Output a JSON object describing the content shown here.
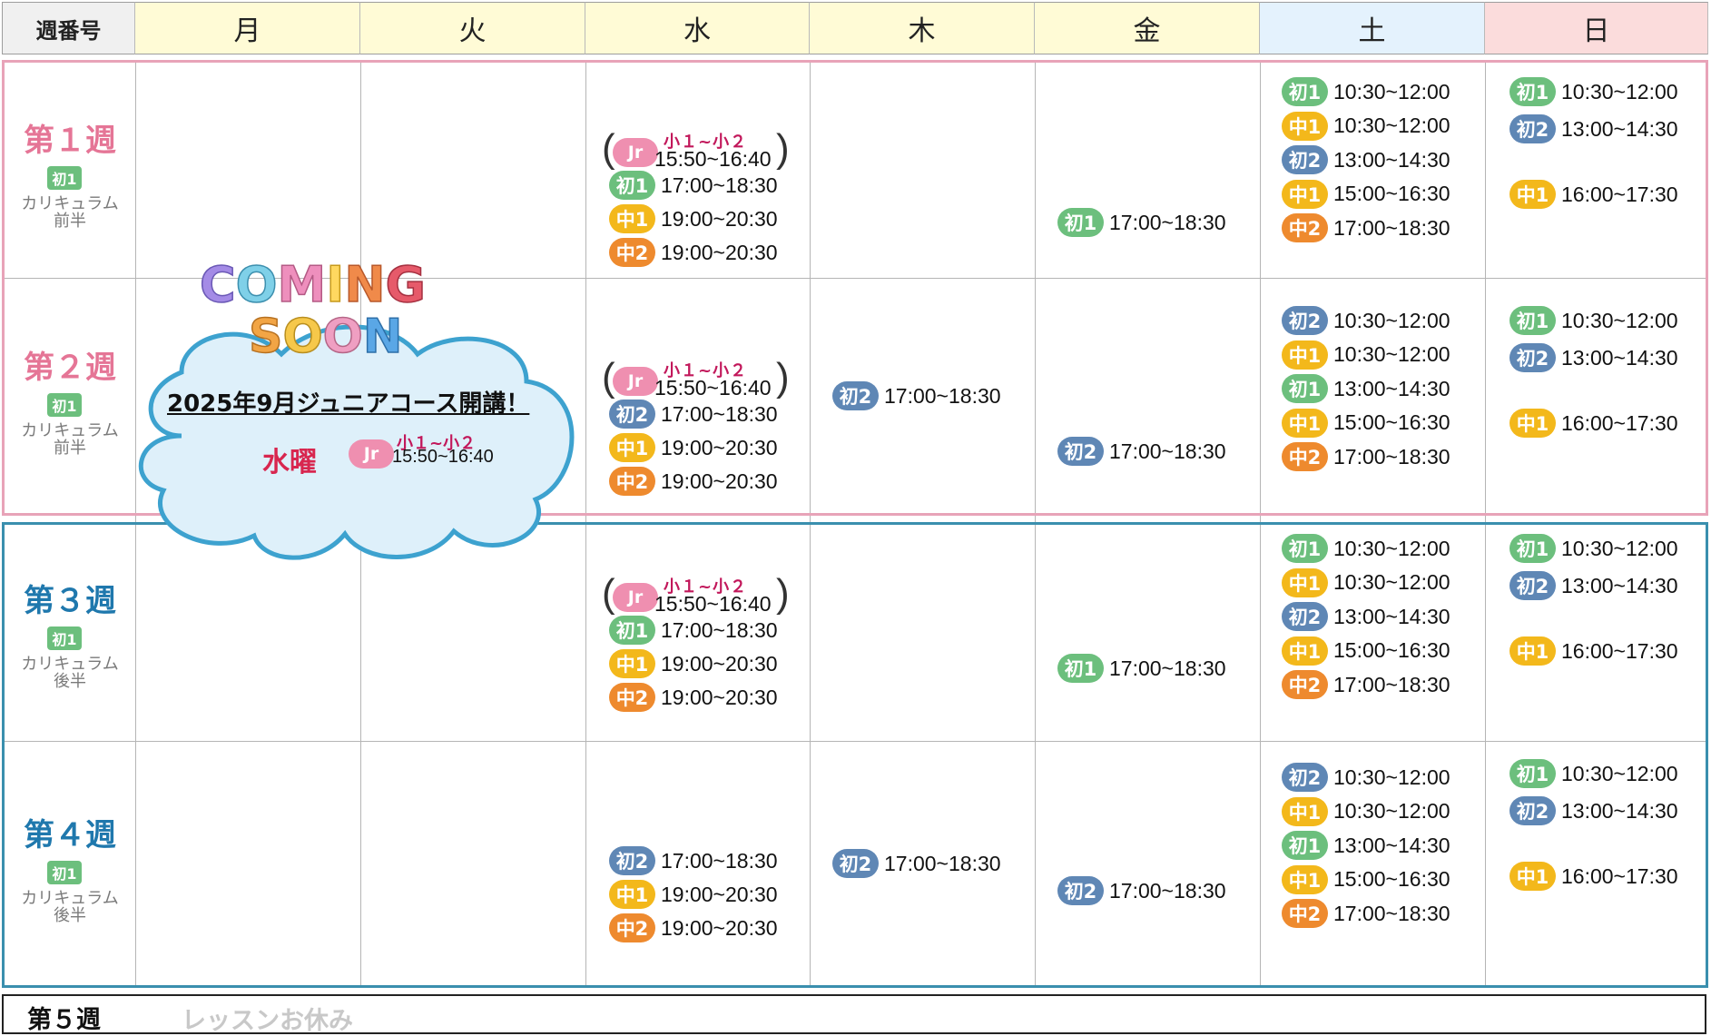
{
  "header": {
    "week_label": "週番号",
    "days": [
      "月",
      "火",
      "水",
      "木",
      "金",
      "土",
      "日"
    ]
  },
  "level_colors": {
    "初1": "#6cbf7d",
    "初2": "#5f87b5",
    "中1": "#f3b81b",
    "中2": "#ee8a2e",
    "Jr": "#ef8fb0"
  },
  "weeks": [
    {
      "title": "第１週",
      "color": "pink",
      "curriculum_badge": "初1",
      "curriculum_text_1": "カリキュラム",
      "curriculum_text_2": "前半",
      "wed_junior": {
        "badge": "Jr",
        "grade": "小１~小２",
        "time": "15:50~16:40"
      },
      "wed": [
        {
          "level": "初1",
          "time": "17:00~18:30"
        },
        {
          "level": "中1",
          "time": "19:00~20:30"
        },
        {
          "level": "中2",
          "time": "19:00~20:30"
        }
      ],
      "thu": [],
      "fri": [
        {
          "level": "初1",
          "time": "17:00~18:30"
        }
      ],
      "sat": [
        {
          "level": "初1",
          "time": "10:30~12:00"
        },
        {
          "level": "中1",
          "time": "10:30~12:00"
        },
        {
          "level": "初2",
          "time": "13:00~14:30"
        },
        {
          "level": "中1",
          "time": "15:00~16:30"
        },
        {
          "level": "中2",
          "time": "17:00~18:30"
        }
      ],
      "sun": [
        {
          "level": "初1",
          "time": "10:30~12:00"
        },
        {
          "level": "初2",
          "time": "13:00~14:30"
        },
        {
          "level": "中1",
          "time": "16:00~17:30"
        }
      ]
    },
    {
      "title": "第２週",
      "color": "pink",
      "curriculum_badge": "初1",
      "curriculum_text_1": "カリキュラム",
      "curriculum_text_2": "前半",
      "wed_junior": {
        "badge": "Jr",
        "grade": "小１~小２",
        "time": "15:50~16:40"
      },
      "wed": [
        {
          "level": "初2",
          "time": "17:00~18:30"
        },
        {
          "level": "中1",
          "time": "19:00~20:30"
        },
        {
          "level": "中2",
          "time": "19:00~20:30"
        }
      ],
      "thu": [
        {
          "level": "初2",
          "time": "17:00~18:30"
        }
      ],
      "fri": [
        {
          "level": "初2",
          "time": "17:00~18:30"
        }
      ],
      "sat": [
        {
          "level": "初2",
          "time": "10:30~12:00"
        },
        {
          "level": "中1",
          "time": "10:30~12:00"
        },
        {
          "level": "初1",
          "time": "13:00~14:30"
        },
        {
          "level": "中1",
          "time": "15:00~16:30"
        },
        {
          "level": "中2",
          "time": "17:00~18:30"
        }
      ],
      "sun": [
        {
          "level": "初1",
          "time": "10:30~12:00"
        },
        {
          "level": "初2",
          "time": "13:00~14:30"
        },
        {
          "level": "中1",
          "time": "16:00~17:30"
        }
      ]
    },
    {
      "title": "第３週",
      "color": "blue",
      "curriculum_badge": "初1",
      "curriculum_text_1": "カリキュラム",
      "curriculum_text_2": "後半",
      "wed_junior": {
        "badge": "Jr",
        "grade": "小１~小２",
        "time": "15:50~16:40"
      },
      "wed": [
        {
          "level": "初1",
          "time": "17:00~18:30"
        },
        {
          "level": "中1",
          "time": "19:00~20:30"
        },
        {
          "level": "中2",
          "time": "19:00~20:30"
        }
      ],
      "thu": [],
      "fri": [
        {
          "level": "初1",
          "time": "17:00~18:30"
        }
      ],
      "sat": [
        {
          "level": "初1",
          "time": "10:30~12:00"
        },
        {
          "level": "中1",
          "time": "10:30~12:00"
        },
        {
          "level": "初2",
          "time": "13:00~14:30"
        },
        {
          "level": "中1",
          "time": "15:00~16:30"
        },
        {
          "level": "中2",
          "time": "17:00~18:30"
        }
      ],
      "sun": [
        {
          "level": "初1",
          "time": "10:30~12:00"
        },
        {
          "level": "初2",
          "time": "13:00~14:30"
        },
        {
          "level": "中1",
          "time": "16:00~17:30"
        }
      ]
    },
    {
      "title": "第４週",
      "color": "blue",
      "curriculum_badge": "初1",
      "curriculum_text_1": "カリキュラム",
      "curriculum_text_2": "後半",
      "wed_junior": null,
      "wed": [
        {
          "level": "初2",
          "time": "17:00~18:30"
        },
        {
          "level": "中1",
          "time": "19:00~20:30"
        },
        {
          "level": "中2",
          "time": "19:00~20:30"
        }
      ],
      "thu": [
        {
          "level": "初2",
          "time": "17:00~18:30"
        }
      ],
      "fri": [
        {
          "level": "初2",
          "time": "17:00~18:30"
        }
      ],
      "sat": [
        {
          "level": "初2",
          "time": "10:30~12:00"
        },
        {
          "level": "中1",
          "time": "10:30~12:00"
        },
        {
          "level": "初1",
          "time": "13:00~14:30"
        },
        {
          "level": "中1",
          "time": "15:00~16:30"
        },
        {
          "level": "中2",
          "time": "17:00~18:30"
        }
      ],
      "sun": [
        {
          "level": "初1",
          "time": "10:30~12:00"
        },
        {
          "level": "初2",
          "time": "13:00~14:30"
        },
        {
          "level": "中1",
          "time": "16:00~17:30"
        }
      ]
    }
  ],
  "week5": {
    "title": "第５週",
    "note": "レッスンお休み"
  },
  "callout": {
    "logo_line1": "COMING",
    "logo_line2": "SOON",
    "headline": "2025年9月ジュニアコース開講！",
    "day": "水曜",
    "badge": "Jr",
    "grade": "小１~小２",
    "time": "15:50~16:40"
  }
}
